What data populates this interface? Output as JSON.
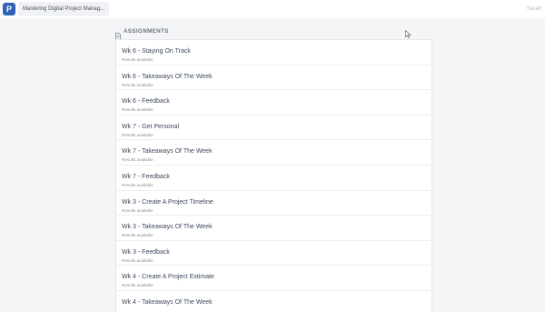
{
  "topbar": {
    "logo_letter": "P",
    "course_title": "Mastering Digital Project Manag...",
    "user_name": "Sarah"
  },
  "section": {
    "title": "ASSIGNMENTS",
    "icon": "document-icon"
  },
  "assignments": [
    {
      "title": "Wk 6 - Staying On Track",
      "status": "Results available"
    },
    {
      "title": "Wk 6 - Takeaways Of The Week",
      "status": "Results available"
    },
    {
      "title": "Wk 6 - Feedback",
      "status": "Results available"
    },
    {
      "title": "Wk 7 - Get Personal",
      "status": "Results available"
    },
    {
      "title": "Wk 7 - Takeaways Of The Week",
      "status": "Results available"
    },
    {
      "title": "Wk 7 - Feedback",
      "status": "Results available"
    },
    {
      "title": "Wk 3 - Create A Project Timeline",
      "status": "Results available"
    },
    {
      "title": "Wk 3 - Takeaways Of The Week",
      "status": "Results available"
    },
    {
      "title": "Wk 3 - Feedback",
      "status": "Results available"
    },
    {
      "title": "Wk 4 - Create A Project Estimate",
      "status": "Results available"
    },
    {
      "title": "Wk 4 - Takeaways Of The Week",
      "status": ""
    }
  ],
  "colors": {
    "brand": "#2f63b7",
    "background": "#f4f5f6",
    "title_text": "#3e4a5c"
  }
}
